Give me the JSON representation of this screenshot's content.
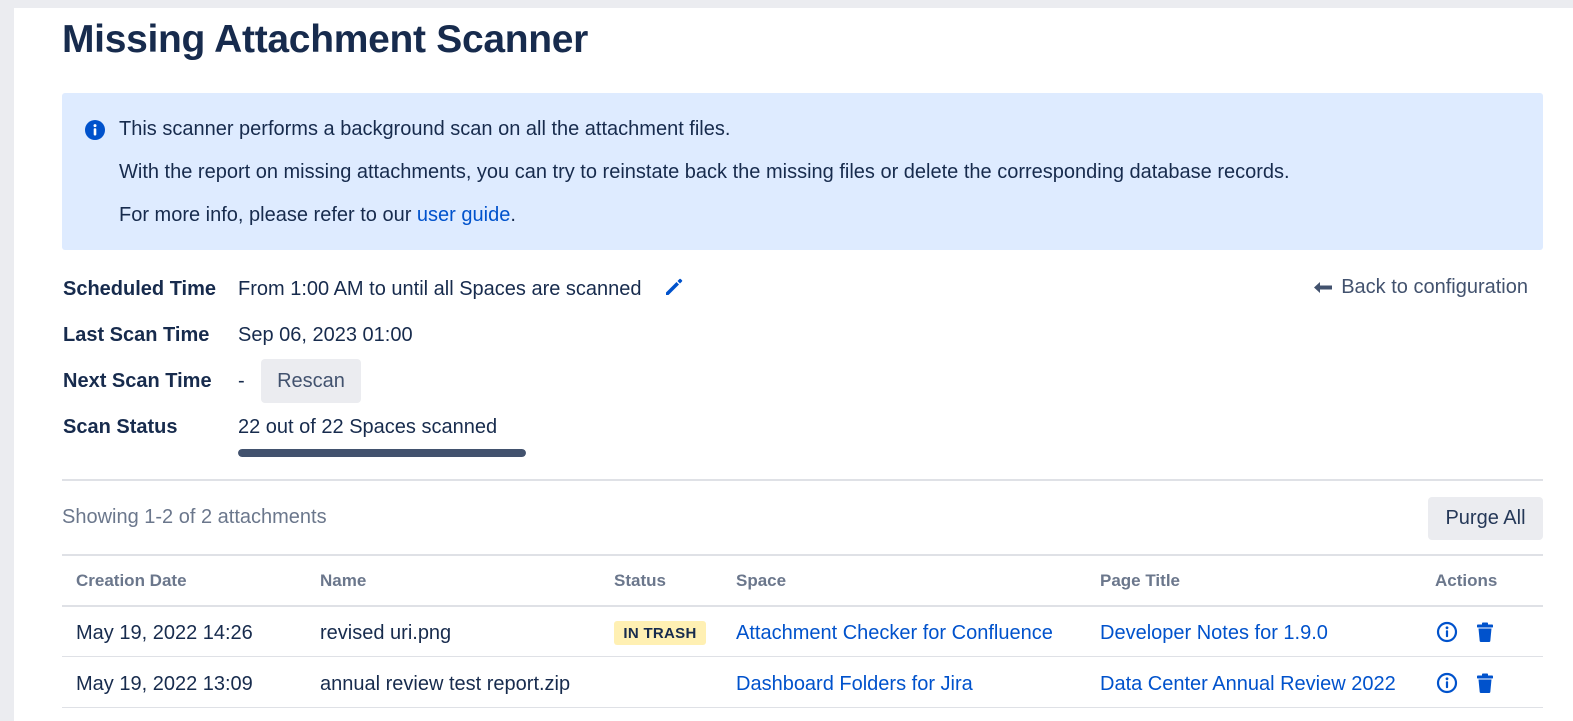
{
  "page": {
    "title": "Missing Attachment Scanner"
  },
  "info": {
    "line1": "This scanner performs a background scan on all the attachment files.",
    "line2": "With the report on missing attachments, you can try to reinstate back the missing files or delete the corresponding database records.",
    "line3_prefix": "For more info, please refer to our ",
    "line3_link": "user guide",
    "line3_suffix": ".",
    "icon": "info-icon"
  },
  "meta": {
    "scheduled_label": "Scheduled Time",
    "scheduled_value": "From 1:00 AM to until all Spaces are scanned",
    "last_label": "Last Scan Time",
    "last_value": "Sep 06, 2023 01:00",
    "next_label": "Next Scan Time",
    "next_value": "-",
    "rescan_label": "Rescan",
    "status_label": "Scan Status",
    "status_value": "22 out of 22 Spaces scanned",
    "progress": 1.0,
    "back_label": "Back to configuration"
  },
  "list": {
    "showing": "Showing 1-2 of 2 attachments",
    "purge_label": "Purge All",
    "columns": [
      "Creation Date",
      "Name",
      "Status",
      "Space",
      "Page Title",
      "Actions"
    ],
    "rows": [
      {
        "date": "May 19, 2022 14:26",
        "name": "revised uri.png",
        "status": "IN TRASH",
        "space": "Attachment Checker for Confluence",
        "page_title": "Developer Notes for 1.9.0"
      },
      {
        "date": "May 19, 2022 13:09",
        "name": "annual review test report.zip",
        "status": "",
        "space": "Dashboard Folders for Jira",
        "page_title": "Data Center Annual Review 2022"
      }
    ]
  },
  "colors": {
    "accent": "#0052cc",
    "info_bg": "#deebff",
    "badge_bg": "#fff0b3",
    "progress": "#42526e"
  }
}
